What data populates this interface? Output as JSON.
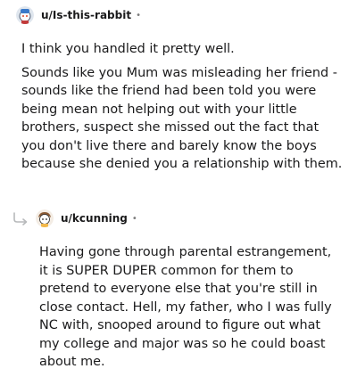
{
  "comments": [
    {
      "username": "u/Is-this-rabbit",
      "dot": "•",
      "avatar_icon": "snoo-avatar-icon",
      "paragraphs": [
        "I think you handled it pretty well.",
        "Sounds like you Mum was misleading her friend - sounds like the friend had been told you were being mean not helping out with your little brothers, suspect she missed out the fact that you don't live there and barely know the boys because she denied you a relationship with them."
      ]
    },
    {
      "username": "u/kcunning",
      "dot": "•",
      "avatar_icon": "snoo-avatar-icon",
      "reply_icon": "reply-arrow-icon",
      "paragraphs": [
        "Having gone through parental estrangement, it is SUPER DUPER common for them to pretend to everyone else that you're still in close contact. Hell, my father, who I was fully NC with, snooped around to figure out what my college and major was so he could boast about me."
      ]
    }
  ]
}
